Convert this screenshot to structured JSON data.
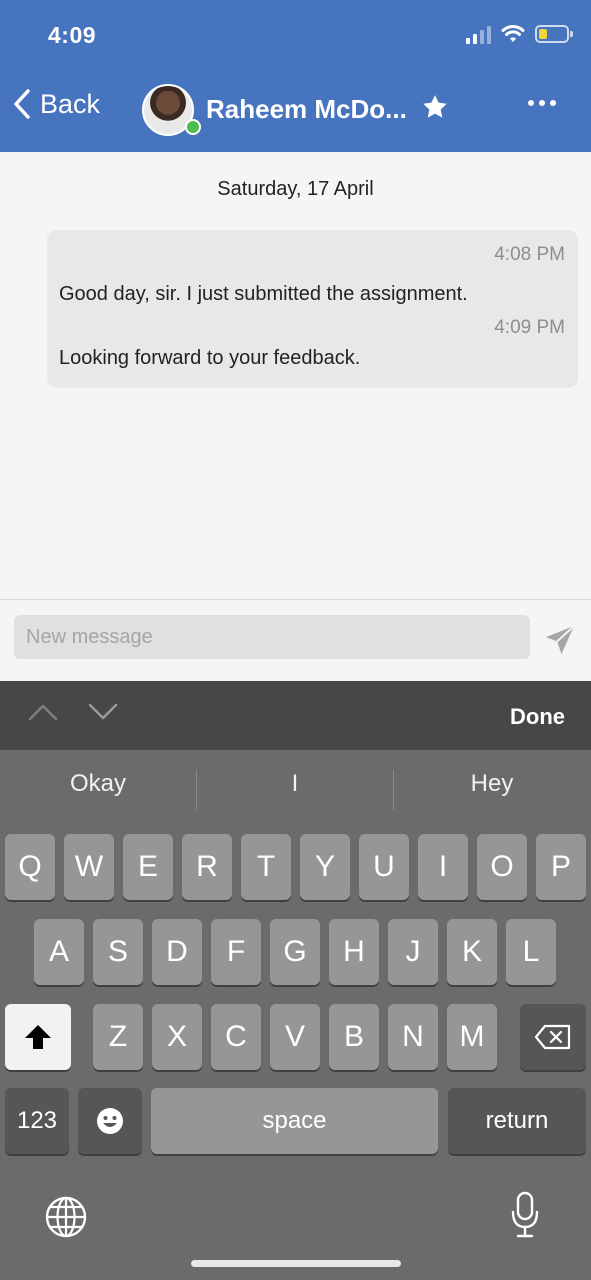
{
  "status_bar": {
    "time": "4:09"
  },
  "header": {
    "back_label": "Back",
    "contact_name": "Raheem McDo..."
  },
  "chat": {
    "date": "Saturday, 17 April",
    "messages": [
      {
        "time": "4:08 PM",
        "text": "Good day, sir. I just submitted the assignment."
      },
      {
        "time": "4:09 PM",
        "text": "Looking forward to your feedback."
      }
    ]
  },
  "composer": {
    "placeholder": "New message"
  },
  "keyboard": {
    "toolbar_done": "Done",
    "suggestions": [
      "Okay",
      "I",
      "Hey"
    ],
    "row1": [
      "Q",
      "W",
      "E",
      "R",
      "T",
      "Y",
      "U",
      "I",
      "O",
      "P"
    ],
    "row2": [
      "A",
      "S",
      "D",
      "F",
      "G",
      "H",
      "J",
      "K",
      "L"
    ],
    "row3": [
      "Z",
      "X",
      "C",
      "V",
      "B",
      "N",
      "M"
    ],
    "numbers_label": "123",
    "space_label": "space",
    "return_label": "return"
  },
  "colors": {
    "header_bg": "#4674bf",
    "online": "#4cbe4f",
    "battery": "#f5d33b"
  },
  "icons": [
    "chevron-left-icon",
    "star-icon",
    "more-icon",
    "send-icon",
    "chevron-up-icon",
    "chevron-down-icon",
    "shift-icon",
    "backspace-icon",
    "emoji-icon",
    "globe-icon",
    "microphone-icon"
  ]
}
